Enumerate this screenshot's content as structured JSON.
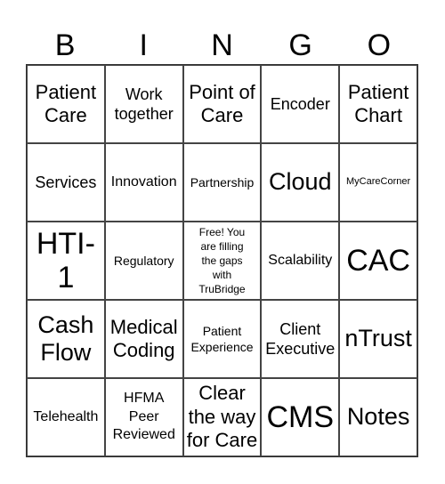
{
  "header": {
    "letters": [
      "B",
      "I",
      "N",
      "G",
      "O"
    ]
  },
  "cells": [
    [
      "Patient Care",
      "Work together",
      "Point of Care",
      "Encoder",
      "Patient Chart"
    ],
    [
      "Services",
      "Innovation",
      "Partnership",
      "Cloud",
      "MyCareCorner"
    ],
    [
      "HTI-1",
      "Regulatory",
      "Free! You are filling the gaps with TruBridge",
      "Scalability",
      "CAC"
    ],
    [
      "Cash Flow",
      "Medical Coding",
      "Patient Experience",
      "Client Executive",
      "nTrust"
    ],
    [
      "Telehealth",
      "HFMA Peer Reviewed",
      "Clear the way for Care",
      "CMS",
      "Notes"
    ]
  ]
}
